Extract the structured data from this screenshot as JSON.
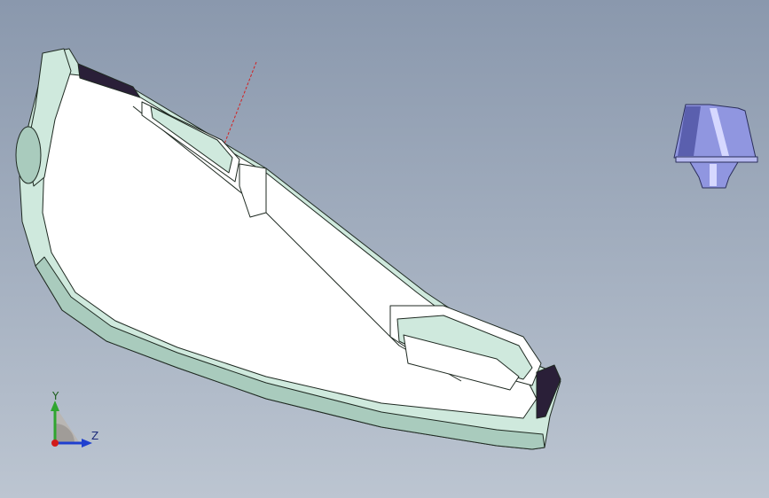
{
  "viewport": {
    "background_top": "#8a98ad",
    "background_bottom": "#bcc5d1"
  },
  "part": {
    "body_color": "#ffffff",
    "edge_color": "#cfe9dd",
    "shade_color": "#a9cbbd",
    "outline_color": "#1f2a22",
    "end_cap_color": "#2a1f38"
  },
  "connector": {
    "color": "#9096e0",
    "highlight": "#d6d8ff",
    "shadow": "#5a5fae"
  },
  "triad": {
    "y_label": "Y",
    "z_label": "Z",
    "y_color": "#2fa52f",
    "z_color": "#1f3fcf",
    "x_color": "#d11a1a"
  }
}
